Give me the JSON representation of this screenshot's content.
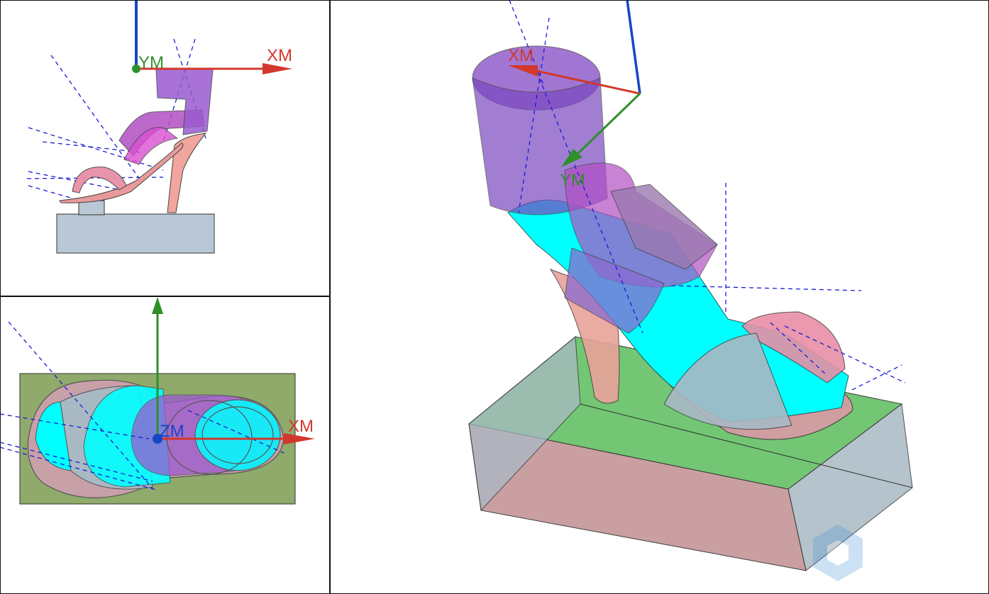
{
  "viewports": {
    "front": {
      "axes": {
        "x_label": "XM",
        "y_label": "YM"
      }
    },
    "top": {
      "axes": {
        "x_label": "XM",
        "z_label": "ZM"
      }
    },
    "iso": {
      "axes": {
        "x_label": "XM",
        "y_label": "YM"
      }
    }
  },
  "colors": {
    "axis_x": "#d2382b",
    "axis_y": "#2f8f2a",
    "axis_z": "#1746c4",
    "block_top": "#6cc46c",
    "block_side": "#a9b9c4",
    "block_front": "#c79a9c",
    "strap_purple": "#8a55c8",
    "strap_magenta": "#d94fd0",
    "sole_pink": "#e89a9a",
    "insole_cyan": "#00ffff",
    "dash_blue": "#1a1ad6",
    "stock_grey": "#b9c8d4",
    "top_stock_green": "#8faa6a"
  }
}
